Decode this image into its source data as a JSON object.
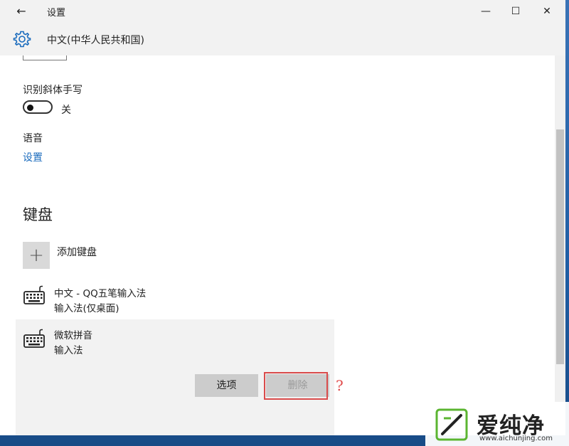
{
  "window": {
    "title": "设置",
    "controls": {
      "minimize": "—",
      "maximize": "☐",
      "close": "✕"
    }
  },
  "header": {
    "title": "中文(中华人民共和国)",
    "icon": "gear-icon"
  },
  "handwriting": {
    "label": "识别斜体手写",
    "toggle_state": "关",
    "toggle_on": false
  },
  "voice": {
    "label": "语音",
    "link": "设置"
  },
  "keyboard_section": {
    "heading": "键盘",
    "add_label": "添加键盘",
    "items": [
      {
        "title": "中文 - QQ五笔输入法",
        "subtitle": "输入法(仅桌面)",
        "icon": "keyboard-icon"
      },
      {
        "title": "微软拼音",
        "subtitle": "输入法",
        "icon": "keyboard-icon",
        "selected": true
      }
    ],
    "options_label": "选项",
    "delete_label": "删除"
  },
  "annotation": {
    "mark": "?",
    "color": "#e04a4a"
  },
  "watermark": {
    "text": "爱纯净",
    "url": "www.aichunjing.com"
  },
  "colors": {
    "accent": "#1a6bbd",
    "highlight": "#d94b4b"
  }
}
